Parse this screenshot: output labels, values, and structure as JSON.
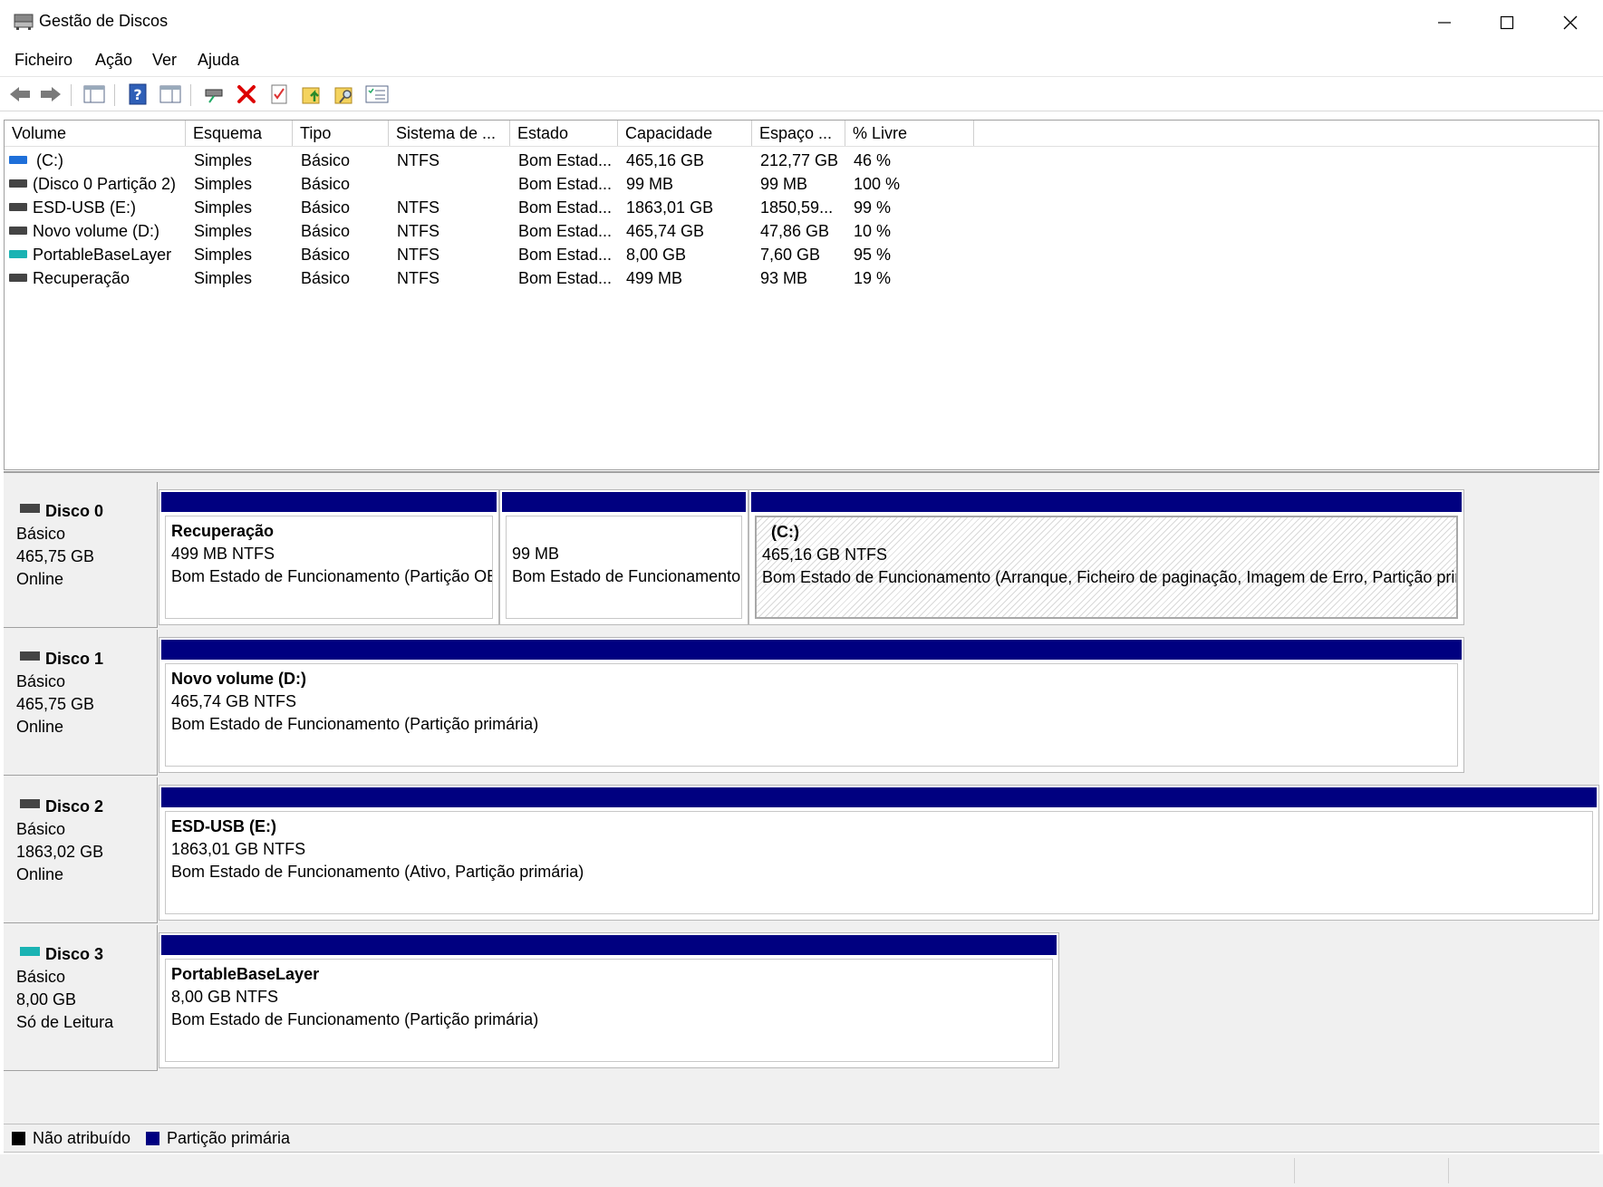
{
  "window": {
    "title": "Gestão de Discos"
  },
  "menu": {
    "file": "Ficheiro",
    "action": "Ação",
    "view": "Ver",
    "help": "Ajuda"
  },
  "columns": [
    "Volume",
    "Esquema",
    "Tipo",
    "Sistema de ...",
    "Estado",
    "Capacidade",
    "Espaço ...",
    "% Livre"
  ],
  "volumes": [
    {
      "name": "(C:)",
      "layout": "Simples",
      "type": "Básico",
      "fs": "NTFS",
      "status": "Bom Estad...",
      "capacity": "465,16 GB",
      "free": "212,77 GB",
      "pct": "46 %",
      "icon": "system-drive-icon"
    },
    {
      "name": "(Disco 0 Partição 2)",
      "layout": "Simples",
      "type": "Básico",
      "fs": "",
      "status": "Bom Estad...",
      "capacity": "99 MB",
      "free": "99 MB",
      "pct": "100 %",
      "icon": "drive-icon"
    },
    {
      "name": "ESD-USB (E:)",
      "layout": "Simples",
      "type": "Básico",
      "fs": "NTFS",
      "status": "Bom Estad...",
      "capacity": "1863,01 GB",
      "free": "1850,59...",
      "pct": "99 %",
      "icon": "drive-icon"
    },
    {
      "name": "Novo volume (D:)",
      "layout": "Simples",
      "type": "Básico",
      "fs": "NTFS",
      "status": "Bom Estad...",
      "capacity": "465,74 GB",
      "free": "47,86 GB",
      "pct": "10 %",
      "icon": "drive-icon"
    },
    {
      "name": "PortableBaseLayer",
      "layout": "Simples",
      "type": "Básico",
      "fs": "NTFS",
      "status": "Bom Estad...",
      "capacity": "8,00 GB",
      "free": "7,60 GB",
      "pct": "95 %",
      "icon": "virtual-drive-icon"
    },
    {
      "name": "Recuperação",
      "layout": "Simples",
      "type": "Básico",
      "fs": "NTFS",
      "status": "Bom Estad...",
      "capacity": "499 MB",
      "free": "93 MB",
      "pct": "19 %",
      "icon": "drive-icon"
    }
  ],
  "disks": [
    {
      "title": "Disco 0",
      "type": "Básico",
      "size": "465,75 GB",
      "state": "Online",
      "partitions": [
        {
          "name": "Recuperação",
          "size": "499 MB NTFS",
          "status": "Bom Estado de Funcionamento (Partição OEM)"
        },
        {
          "name": "",
          "size": "99 MB",
          "status": "Bom Estado de Funcionamento (Partição do Sistema EFI)"
        },
        {
          "name": "(C:)",
          "size": "465,16 GB NTFS",
          "status": "Bom Estado de Funcionamento (Arranque, Ficheiro de paginação, Imagem de Erro, Partição primária)"
        }
      ]
    },
    {
      "title": "Disco 1",
      "type": "Básico",
      "size": "465,75 GB",
      "state": "Online",
      "partitions": [
        {
          "name": "Novo volume  (D:)",
          "size": "465,74 GB NTFS",
          "status": "Bom Estado de Funcionamento (Partição primária)"
        }
      ]
    },
    {
      "title": "Disco 2",
      "type": "Básico",
      "size": "1863,02 GB",
      "state": "Online",
      "partitions": [
        {
          "name": "ESD-USB  (E:)",
          "size": "1863,01 GB NTFS",
          "status": "Bom Estado de Funcionamento (Ativo, Partição primária)"
        }
      ]
    },
    {
      "title": "Disco 3",
      "type": "Básico",
      "size": "8,00 GB",
      "state": "Só de Leitura",
      "partitions": [
        {
          "name": "PortableBaseLayer",
          "size": "8,00 GB NTFS",
          "status": "Bom Estado de Funcionamento (Partição primária)"
        }
      ]
    }
  ],
  "legend": {
    "unallocated": "Não atribuído",
    "primary": "Partição primária"
  },
  "colors": {
    "primary": "#000080",
    "unallocated": "#000000",
    "drive_blue": "#1e6fd9",
    "drive_teal": "#1ab3b3"
  }
}
